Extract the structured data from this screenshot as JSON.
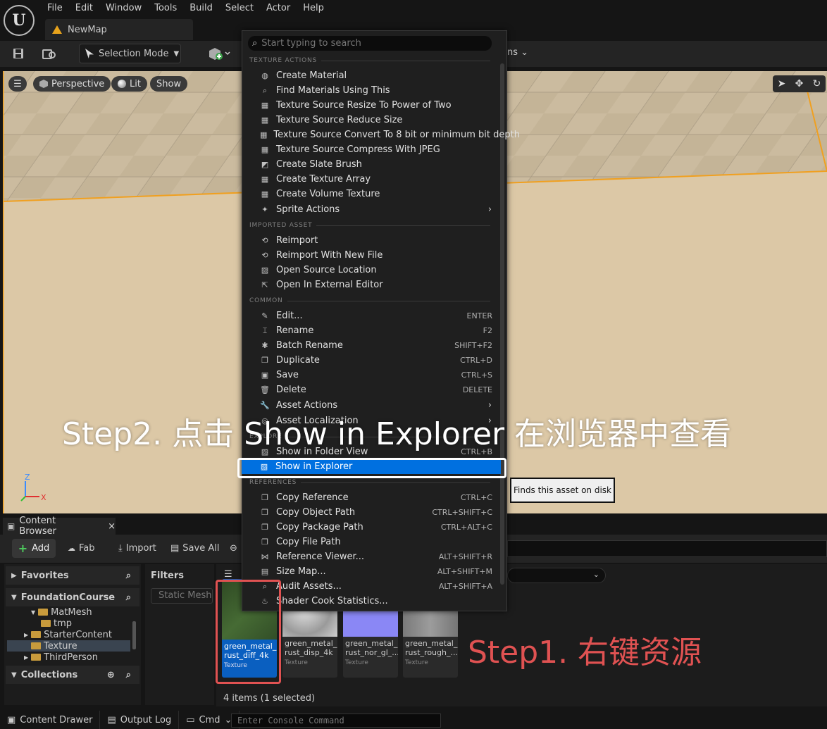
{
  "menubar": [
    "File",
    "Edit",
    "Window",
    "Tools",
    "Build",
    "Select",
    "Actor",
    "Help"
  ],
  "map_tab": "NewMap",
  "toolbar": {
    "selection_mode": "Selection Mode",
    "partial_label": "ns"
  },
  "viewport": {
    "perspective": "Perspective",
    "lit": "Lit",
    "show": "Show",
    "axis_z": "Z",
    "axis_x": "X"
  },
  "context_menu": {
    "search_placeholder": "Start typing to search",
    "headers": {
      "texture_actions": "TEXTURE ACTIONS",
      "imported_asset": "IMPORTED ASSET",
      "common": "COMMON",
      "explore": "EXPLORE",
      "references": "REFERENCES"
    },
    "items": {
      "create_material": "Create Material",
      "find_materials": "Find Materials Using This",
      "resize_pow2": "Texture Source Resize To Power of Two",
      "reduce_size": "Texture Source Reduce Size",
      "convert_8bit": "Texture Source Convert To 8 bit or minimum bit depth",
      "compress_jpeg": "Texture Source Compress With JPEG",
      "create_slate_brush": "Create Slate Brush",
      "create_texture_array": "Create Texture Array",
      "create_volume_texture": "Create Volume Texture",
      "sprite_actions": "Sprite Actions",
      "reimport": "Reimport",
      "reimport_new_file": "Reimport With New File",
      "open_source_location": "Open Source Location",
      "open_external_editor": "Open In External Editor",
      "edit": "Edit...",
      "rename": "Rename",
      "batch_rename": "Batch Rename",
      "duplicate": "Duplicate",
      "save": "Save",
      "delete": "Delete",
      "asset_actions": "Asset Actions",
      "asset_localization": "Asset Localization",
      "show_in_folder_view": "Show in Folder View",
      "show_in_explorer": "Show in Explorer",
      "copy_reference": "Copy Reference",
      "copy_object_path": "Copy Object Path",
      "copy_package_path": "Copy Package Path",
      "copy_file_path": "Copy File Path",
      "reference_viewer": "Reference Viewer...",
      "size_map": "Size Map...",
      "audit_assets": "Audit Assets...",
      "shader_cook_stats": "Shader Cook Statistics..."
    },
    "shortcuts": {
      "edit": "ENTER",
      "rename": "F2",
      "batch_rename": "SHIFT+F2",
      "duplicate": "CTRL+D",
      "save": "CTRL+S",
      "delete": "DELETE",
      "show_in_folder_view": "CTRL+B",
      "copy_reference": "CTRL+C",
      "copy_object_path": "CTRL+SHIFT+C",
      "copy_package_path": "CTRL+ALT+C",
      "reference_viewer": "ALT+SHIFT+R",
      "size_map": "ALT+SHIFT+M",
      "audit_assets": "ALT+SHIFT+A"
    }
  },
  "tooltip": "Finds this asset on disk",
  "content_browser": {
    "tab": "Content Browser",
    "add": "Add",
    "fab": "Fab",
    "import": "Import",
    "save_all": "Save All",
    "favorites": "Favorites",
    "project": "FoundationCourse",
    "tree": {
      "matmesh": "MatMesh",
      "tmp": "tmp",
      "starter": "StarterContent",
      "texture": "Texture",
      "thirdperson": "ThirdPerson"
    },
    "collections": "Collections",
    "filters": "Filters",
    "filter_chip": "Static Mesh",
    "assets": [
      {
        "name": "green_metal_\nrust_diff_4k",
        "type": "Texture"
      },
      {
        "name": "green_metal_\nrust_disp_4k",
        "type": "Texture"
      },
      {
        "name": "green_metal_\nrust_nor_gl_...",
        "type": "Texture"
      },
      {
        "name": "green_metal_\nrust_rough_...",
        "type": "Texture"
      }
    ],
    "count": "4 items (1 selected)"
  },
  "statusbar": {
    "content_drawer": "Content Drawer",
    "output_log": "Output Log",
    "cmd": "Cmd",
    "console_placeholder": "Enter Console Command"
  },
  "annotations": {
    "step1": "Step1. 右键资源",
    "step2": "Step2. 点击 Show in Explorer 在浏览器中查看"
  },
  "colors": {
    "highlight": "#0070e0",
    "annotation_red": "#e05252",
    "floor": "#d9c8a8",
    "edge": "#f0a020"
  }
}
